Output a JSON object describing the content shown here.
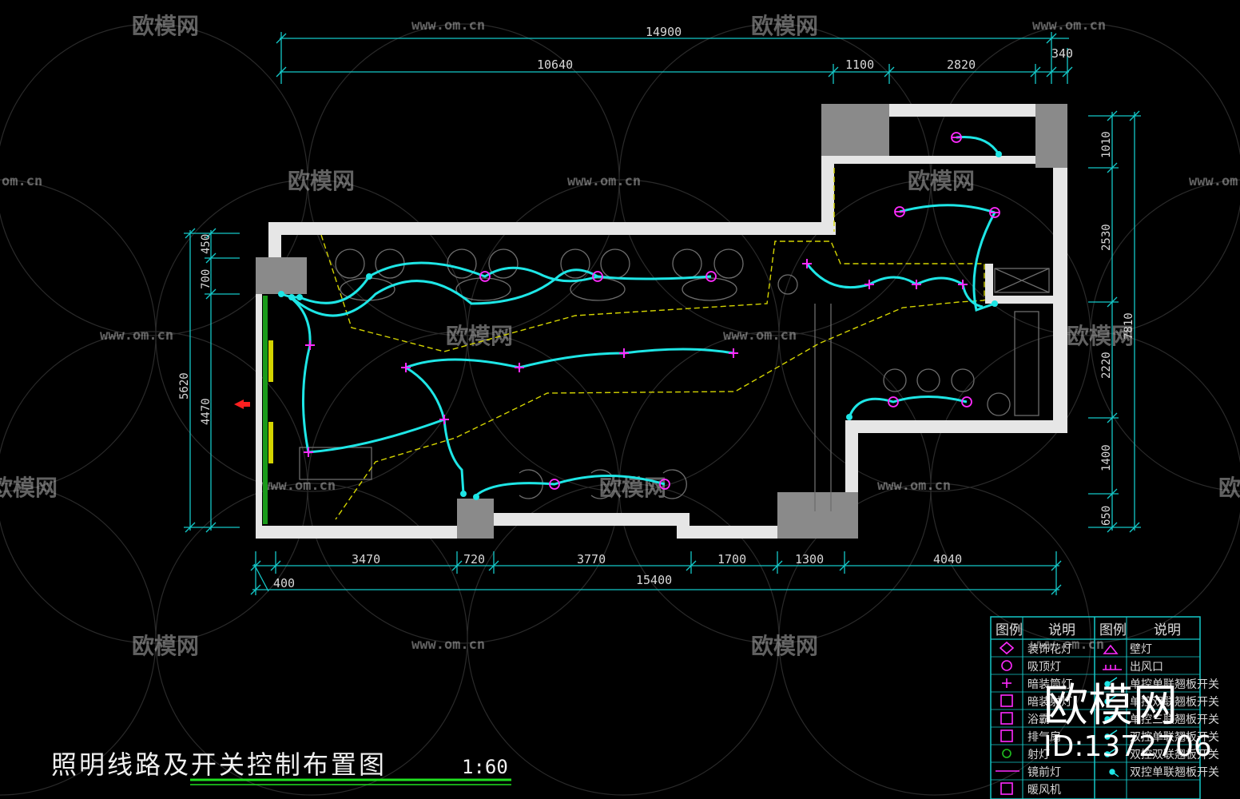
{
  "drawing": {
    "title": "照明线路及开关控制布置图",
    "scale": "1:60"
  },
  "dimensions": {
    "top_overall": "14900",
    "top_segments": [
      "10640",
      "1100",
      "2820",
      "340"
    ],
    "bottom_overall": "15400",
    "bottom_segments": [
      "3470",
      "720",
      "3770",
      "1700",
      "1300",
      "4040"
    ],
    "bottom_left_small": "400",
    "left_overall": "5620",
    "left_segments": [
      "450",
      "700",
      "4470"
    ],
    "right_overall": "7810",
    "right_segments": [
      "1010",
      "2530",
      "2220",
      "1400",
      "650"
    ]
  },
  "legend": {
    "headers": [
      "图例",
      "说明",
      "图例",
      "说明"
    ],
    "left_items": [
      {
        "icon": "decorative-chandelier-icon",
        "label": "装饰花灯"
      },
      {
        "icon": "ceiling-lamp-icon",
        "label": "吸顶灯"
      },
      {
        "icon": "recessed-light-icon",
        "label": "暗装筒灯"
      },
      {
        "icon": "recessed-downlight-box-icon",
        "label": "暗装射灯"
      },
      {
        "icon": "bath-heater-icon",
        "label": "浴霸"
      },
      {
        "icon": "exhaust-fan-icon",
        "label": "排气扇"
      },
      {
        "icon": "spotlight-icon",
        "label": "射灯"
      },
      {
        "icon": "mirror-light-icon",
        "label": "镜前灯"
      },
      {
        "icon": "heater-fan-icon",
        "label": "暖风机"
      }
    ],
    "right_items": [
      {
        "icon": "wall-lamp-icon",
        "label": "壁灯"
      },
      {
        "icon": "air-outlet-icon",
        "label": "出风口"
      },
      {
        "icon": "switch-icon",
        "label": "单控单联翘板开关"
      },
      {
        "icon": "switch-icon",
        "label": "单控双联翘板开关"
      },
      {
        "icon": "switch-icon",
        "label": "单控三联翘板开关"
      },
      {
        "icon": "switch-icon",
        "label": "双控单联翘板开关"
      },
      {
        "icon": "switch-icon",
        "label": "双控双联翘板开关"
      },
      {
        "icon": "switch-icon",
        "label": "双控单联翘板开关"
      }
    ]
  },
  "watermark": {
    "brand": "欧模网",
    "url": "www.om.cn",
    "url_short": "om.cn",
    "id": "ID:1372706"
  },
  "colors": {
    "background": "#000000",
    "wall": "#e6e6e6",
    "column": "#8a8a8a",
    "wire": "#1ee6e6",
    "lamp": "#ff2bff",
    "dimension": "#14c8c8",
    "ceiling_line": "#d4d400",
    "entrance_arrow": "#ff2020",
    "glass": "#20c020"
  }
}
